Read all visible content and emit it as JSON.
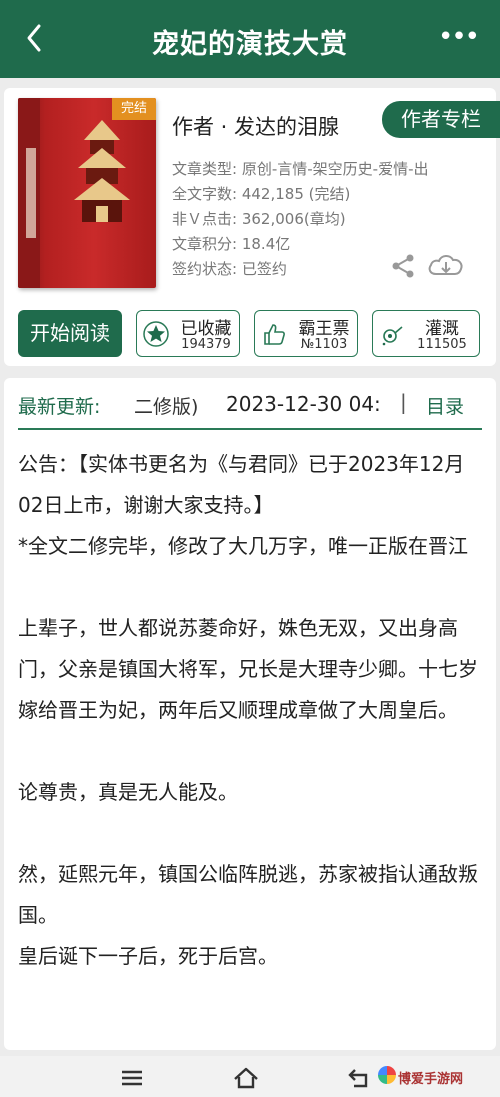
{
  "header": {
    "title": "宠妃的演技大赏",
    "back_glyph": "‹",
    "more_glyph": "•••"
  },
  "book": {
    "cover_badge": "完结",
    "author_line": "作者 · 发达的泪腺",
    "author_column_label": "作者专栏",
    "meta": [
      {
        "key": "文章类型:",
        "value": "原创-言情-架空历史-爱情-出"
      },
      {
        "key": "全文字数:",
        "value": "442,185 (完结)"
      },
      {
        "key": "非Ｖ点击:",
        "value": "362,006(章均)"
      },
      {
        "key": "文章积分:",
        "value": "18.4亿"
      },
      {
        "key": "签约状态:",
        "value": "已签约"
      }
    ],
    "actions": {
      "read_label": "开始阅读",
      "collect": {
        "label": "已收藏",
        "count": "194379"
      },
      "bawang": {
        "label": "霸王票",
        "count": "№1103"
      },
      "irrigate": {
        "label": "灌溉",
        "count": "111505"
      }
    }
  },
  "update": {
    "label": "最新更新:",
    "chapter": "二修版)",
    "date": "2023-12-30 04:",
    "separator": "|",
    "toc_label": "目录"
  },
  "paragraphs": [
    "公告：【实体书更名为《与君同》已于2023年12月02日上市，谢谢大家支持。】",
    "*全文二修完毕，修改了大几万字，唯一正版在晋江",
    "",
    "上辈子，世人都说苏菱命好，姝色无双，又出身高门，父亲是镇国大将军，兄长是大理寺少卿。十七岁嫁给晋王为妃，两年后又顺理成章做了大周皇后。",
    "",
    "论尊贵，真是无人能及。",
    "",
    "然，延熙元年，镇国公临阵脱逃，苏家被指认通敌叛国。",
    "皇后诞下一子后，死于后宫。"
  ],
  "watermark": "博爱手游网",
  "colors": {
    "brand_green": "#1f6b4c",
    "badge_orange": "#e39020"
  }
}
